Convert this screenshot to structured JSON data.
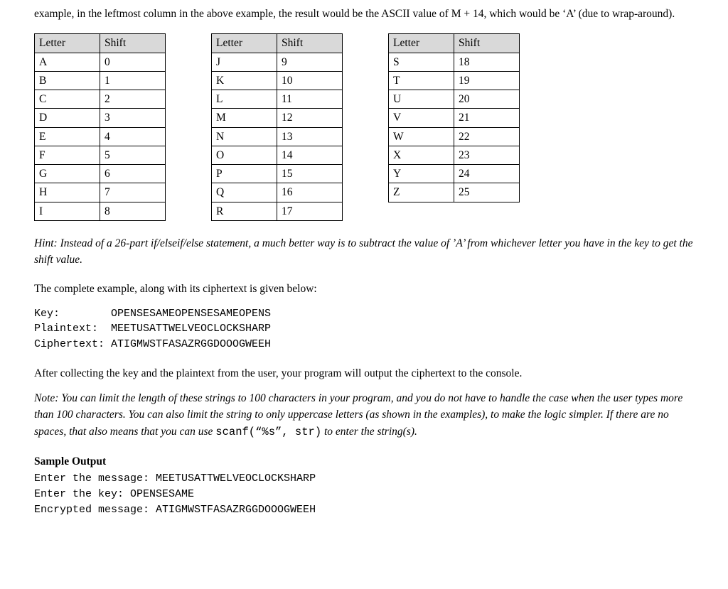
{
  "intro_para": "example, in the leftmost column in the above example, the result would be the ASCII value of M + 14, which would be ‘A’ (due to wrap-around).",
  "tables": {
    "header_letter": "Letter",
    "header_shift": "Shift",
    "col1": [
      {
        "letter": "A",
        "shift": "0"
      },
      {
        "letter": "B",
        "shift": "1"
      },
      {
        "letter": "C",
        "shift": "2"
      },
      {
        "letter": "D",
        "shift": "3"
      },
      {
        "letter": "E",
        "shift": "4"
      },
      {
        "letter": "F",
        "shift": "5"
      },
      {
        "letter": "G",
        "shift": "6"
      },
      {
        "letter": "H",
        "shift": "7"
      },
      {
        "letter": "I",
        "shift": "8"
      }
    ],
    "col2": [
      {
        "letter": "J",
        "shift": "9"
      },
      {
        "letter": "K",
        "shift": "10"
      },
      {
        "letter": "L",
        "shift": "11"
      },
      {
        "letter": "M",
        "shift": "12"
      },
      {
        "letter": "N",
        "shift": "13"
      },
      {
        "letter": "O",
        "shift": "14"
      },
      {
        "letter": "P",
        "shift": "15"
      },
      {
        "letter": "Q",
        "shift": "16"
      },
      {
        "letter": "R",
        "shift": "17"
      }
    ],
    "col3": [
      {
        "letter": "S",
        "shift": "18"
      },
      {
        "letter": "T",
        "shift": "19"
      },
      {
        "letter": "U",
        "shift": "20"
      },
      {
        "letter": "V",
        "shift": "21"
      },
      {
        "letter": "W",
        "shift": "22"
      },
      {
        "letter": "X",
        "shift": "23"
      },
      {
        "letter": "Y",
        "shift": "24"
      },
      {
        "letter": "Z",
        "shift": "25"
      }
    ]
  },
  "hint": {
    "label": "Hint:",
    "body": "Instead of a 26-part if/elseif/else statement, a much better way is to subtract the value of ’A’ from whichever letter you have in the key to get the shift value."
  },
  "example_para": "The complete example, along with its ciphertext is given below:",
  "key_code": "Key:        OPENSESAMEOPENSESAMEOPENS\nPlaintext:  MEETUSATTWELVEOCLOCKSHARP\nCiphertext: ATIGMWSTFASAZRGGDOOOGWEEH",
  "after_para": "After collecting the key and the plaintext from the user, your program will output the ciphertext to the console.",
  "note": {
    "label": "Note:",
    "body_1": "You can limit the length of these strings to 100 characters in your program, and you do not have to handle the case when the user types more than 100 characters. You can also limit the string to only uppercase letters (as shown in the examples), to make the logic simpler. If there are no spaces, that also means that you can use ",
    "code": "scanf(“%s”, str)",
    "body_2": " to enter the string(s)."
  },
  "sample": {
    "heading": "Sample Output",
    "lines": "Enter the message: MEETUSATTWELVEOCLOCKSHARP\nEnter the key: OPENSESAME\nEncrypted message: ATIGMWSTFASAZRGGDOOOGWEEH"
  }
}
